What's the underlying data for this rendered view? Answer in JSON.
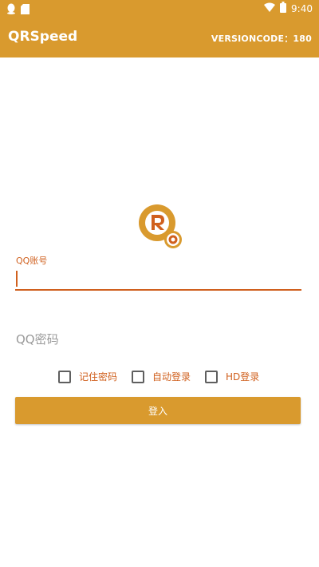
{
  "status_bar": {
    "time": "9:40",
    "icons": [
      "qq-notification-icon",
      "storage-icon",
      "wifi-icon",
      "battery-icon"
    ]
  },
  "app_bar": {
    "title": "QRSpeed",
    "version": "VERSIONCODE：180"
  },
  "login": {
    "username_label": "QQ账号",
    "username_value": "",
    "password_placeholder": "QQ密码",
    "options": [
      {
        "label": "记住密码",
        "checked": false
      },
      {
        "label": "自动登录",
        "checked": false
      },
      {
        "label": "HD登录",
        "checked": false
      }
    ],
    "login_button": "登入"
  },
  "colors": {
    "primary": "#d99a2e",
    "accent": "#d0601e"
  }
}
